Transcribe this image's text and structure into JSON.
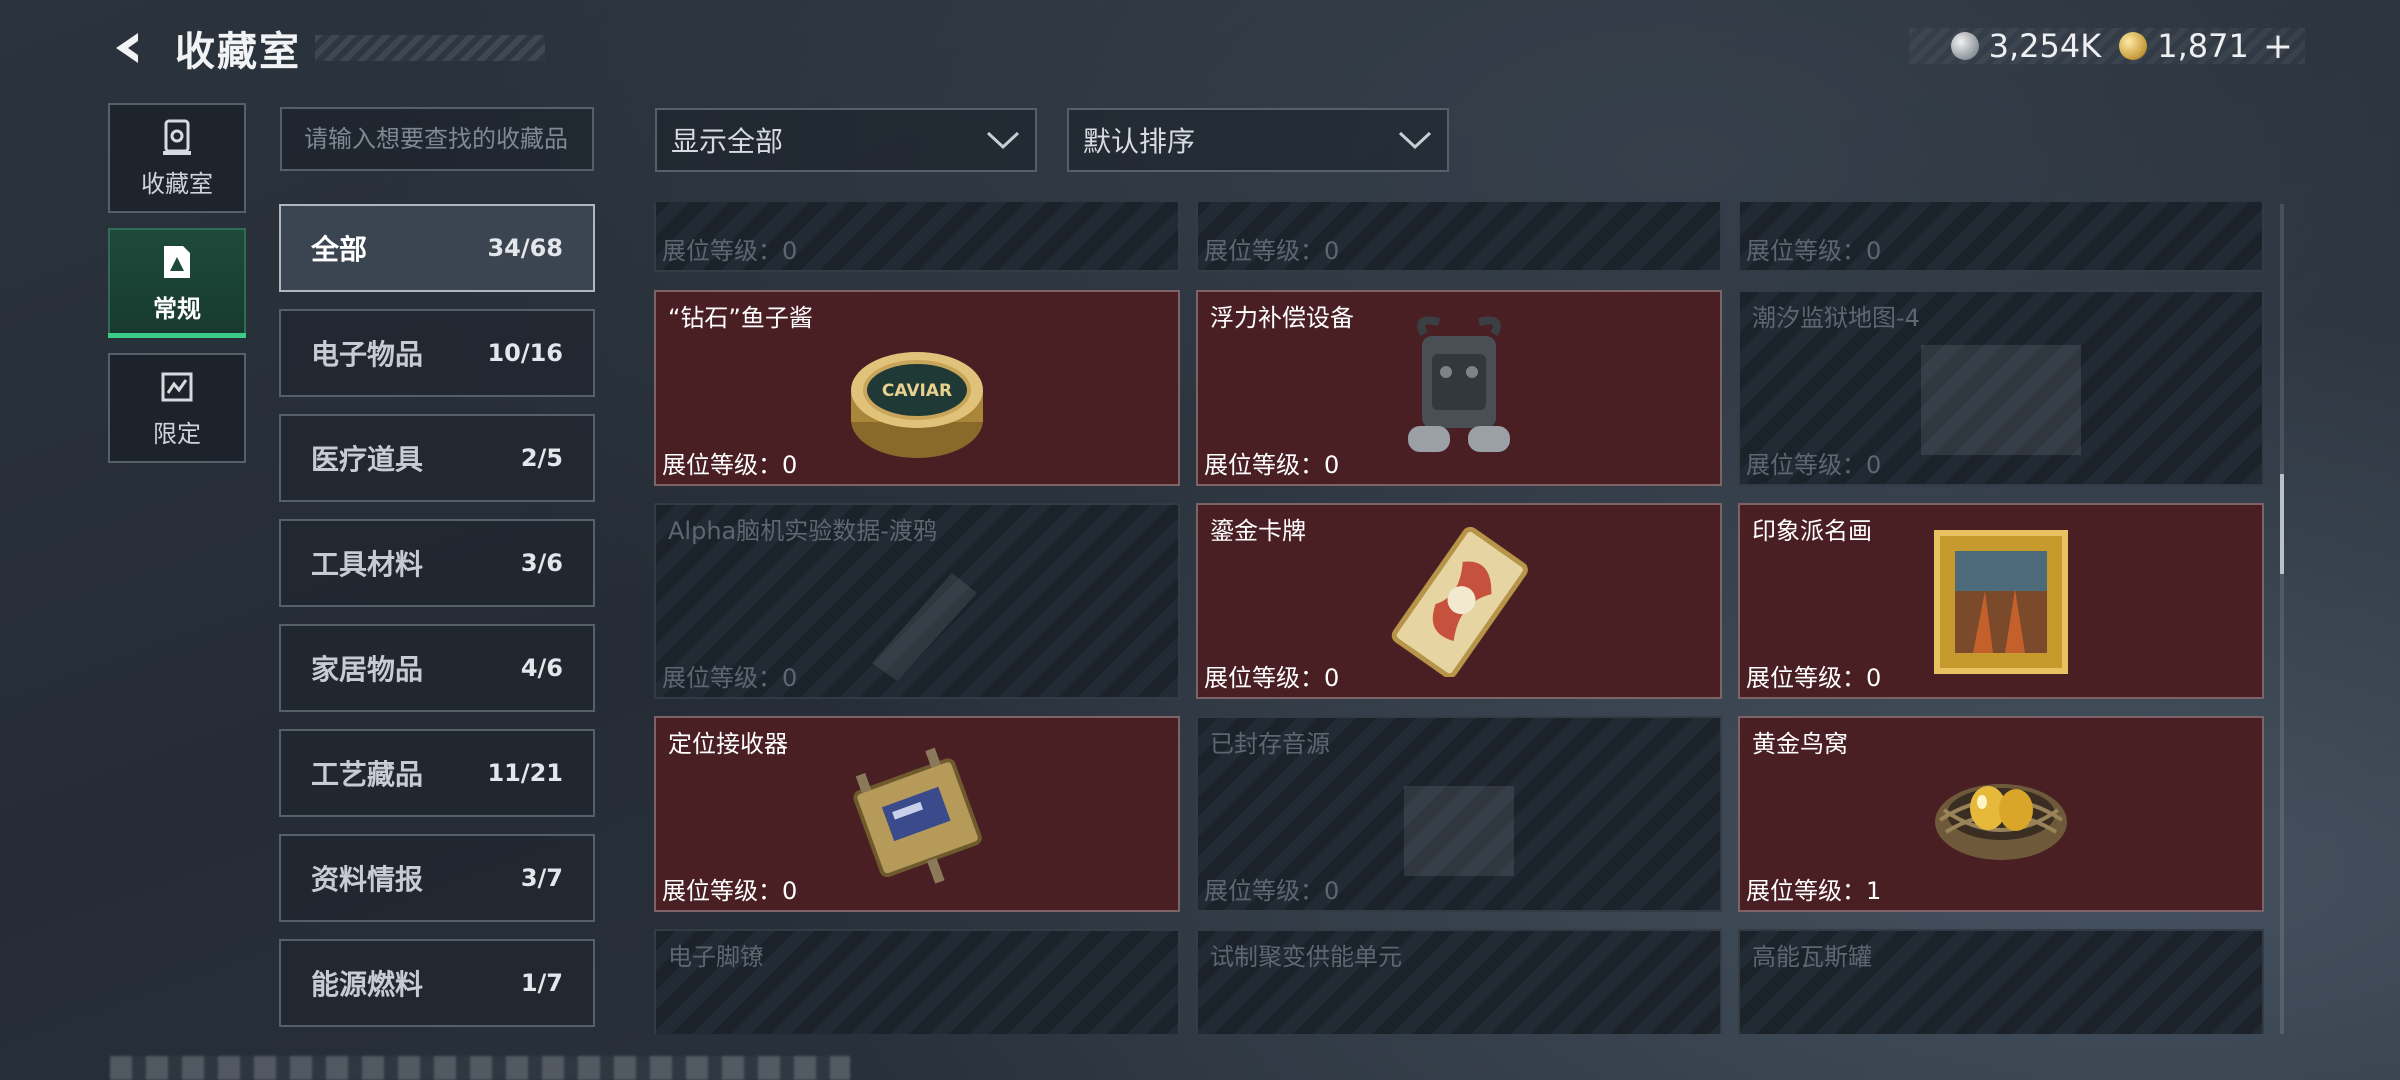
{
  "header": {
    "title": "收藏室"
  },
  "currency": {
    "silver": "3,254K",
    "gold": "1,871",
    "plus": "+"
  },
  "tabs": [
    {
      "label": "收藏室",
      "icon": "trophy-icon",
      "active": false
    },
    {
      "label": "常规",
      "icon": "document-icon",
      "active": true
    },
    {
      "label": "限定",
      "icon": "limited-icon",
      "active": false
    }
  ],
  "search": {
    "placeholder": "请输入想要查找的收藏品"
  },
  "filters": {
    "show": "显示全部",
    "sort": "默认排序"
  },
  "categories": [
    {
      "name": "全部",
      "count": "34/68",
      "active": true
    },
    {
      "name": "电子物品",
      "count": "10/16",
      "active": false
    },
    {
      "name": "医疗道具",
      "count": "2/5",
      "active": false
    },
    {
      "name": "工具材料",
      "count": "3/6",
      "active": false
    },
    {
      "name": "家居物品",
      "count": "4/6",
      "active": false
    },
    {
      "name": "工艺藏品",
      "count": "11/21",
      "active": false
    },
    {
      "name": "资料情报",
      "count": "3/7",
      "active": false
    },
    {
      "name": "能源燃料",
      "count": "1/7",
      "active": false
    }
  ],
  "level_label": "展位等级：",
  "items": [
    {
      "name": "",
      "level": "0",
      "owned": false,
      "icon": "unknown-item-icon"
    },
    {
      "name": "",
      "level": "0",
      "owned": false,
      "icon": "unknown-item-icon"
    },
    {
      "name": "",
      "level": "0",
      "owned": false,
      "icon": "unknown-item-icon"
    },
    {
      "name": "“钻石”鱼子酱",
      "level": "0",
      "owned": true,
      "icon": "caviar-tin-icon"
    },
    {
      "name": "浮力补偿设备",
      "level": "0",
      "owned": true,
      "icon": "buoyancy-device-icon"
    },
    {
      "name": "潮汐监狱地图-4",
      "level": "0",
      "owned": false,
      "icon": "map-icon"
    },
    {
      "name": "Alpha脑机实验数据-渡鸦",
      "level": "0",
      "owned": false,
      "icon": "data-drive-icon"
    },
    {
      "name": "鎏金卡牌",
      "level": "0",
      "owned": true,
      "icon": "gold-card-icon"
    },
    {
      "name": "印象派名画",
      "level": "0",
      "owned": true,
      "icon": "painting-icon"
    },
    {
      "name": "定位接收器",
      "level": "0",
      "owned": true,
      "icon": "receiver-icon"
    },
    {
      "name": "已封存音源",
      "level": "0",
      "owned": false,
      "icon": "audio-source-icon"
    },
    {
      "name": "黄金鸟窝",
      "level": "1",
      "owned": true,
      "icon": "golden-nest-icon"
    },
    {
      "name": "电子脚镣",
      "level": "",
      "owned": false,
      "icon": "ankle-monitor-icon"
    },
    {
      "name": "试制聚变供能单元",
      "level": "",
      "owned": false,
      "icon": "fusion-unit-icon"
    },
    {
      "name": "高能瓦斯罐",
      "level": "",
      "owned": false,
      "icon": "gas-tank-icon"
    }
  ],
  "art_text": {
    "caviar": "CAVIAR"
  },
  "colors": {
    "owned_card": "#4a1f24",
    "active_tab": "#1e4a3b",
    "active_tab_bar": "#3ccc8a"
  }
}
